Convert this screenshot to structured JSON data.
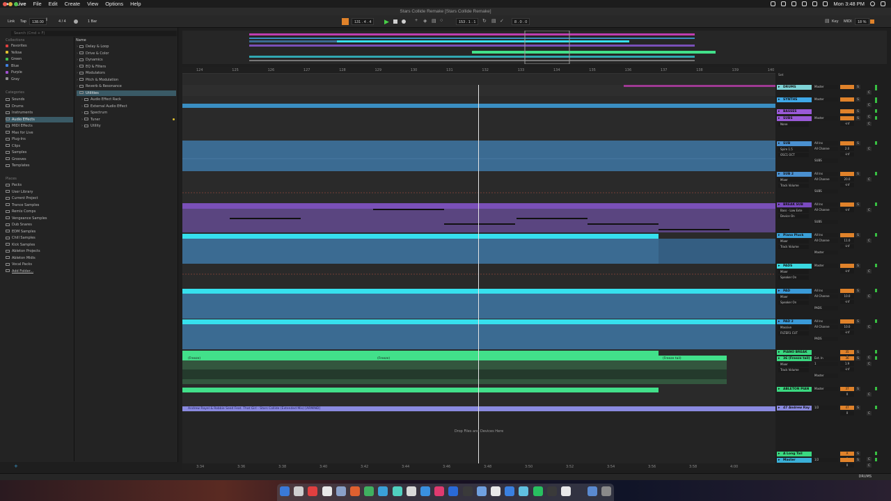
{
  "menubar": {
    "apple": "",
    "app": "Live",
    "items": [
      "File",
      "Edit",
      "Create",
      "View",
      "Options",
      "Help"
    ],
    "clock": "Mon 3:48 PM"
  },
  "window": {
    "title": "Stars Collide Remake  [Stars Collide Remake]"
  },
  "transport": {
    "link": "Link",
    "tap": "Tap",
    "tempo": "138.00",
    "signature": "4 / 4",
    "quantize": "1 Bar",
    "position": "131 .  4 .  4",
    "punch_in": "153 .  1 .  1",
    "loop_len": "8 .  0 .  0",
    "key": "Key",
    "midi": "MIDI",
    "cpu": "18 %"
  },
  "browser": {
    "search_placeholder": "Search (Cmd + F)",
    "collections_header": "Collections",
    "collections": [
      {
        "label": "Favorites",
        "color": "#e04040"
      },
      {
        "label": "Yellow",
        "color": "#e0c030"
      },
      {
        "label": "Green",
        "color": "#40c050"
      },
      {
        "label": "Blue",
        "color": "#4080e0"
      },
      {
        "label": "Purple",
        "color": "#a050d0"
      },
      {
        "label": "Gray",
        "color": "#909090"
      }
    ],
    "categories_header": "Categories",
    "categories": [
      "Sounds",
      "Drums",
      "Instruments",
      "Audio Effects",
      "MIDI Effects",
      "Max for Live",
      "Plug-Ins",
      "Clips",
      "Samples",
      "Grooves",
      "Templates"
    ],
    "places_header": "Places",
    "places": [
      "Packs",
      "User Library",
      "Current Project",
      "Trance Samples",
      "Remix Comps",
      "Vengeance Samples",
      "Dub Snares",
      "EDM Samples",
      "Chill Samples",
      "Kick Samples",
      "Ableton Projects",
      "Ableton Midis",
      "Vocal Packs",
      "Add Folder..."
    ],
    "name_header": "Name",
    "items": [
      "Delay & Loop",
      "Drive & Color",
      "Dynamics",
      "EQ & Filters",
      "Modulators",
      "Pitch & Modulation",
      "Reverb & Resonance",
      "Utilities",
      "Audio Effect Rack",
      "External Audio Effect",
      "Spectrum",
      "Tuner",
      "Utility"
    ]
  },
  "ruler": [
    "124",
    "125",
    "126",
    "127",
    "128",
    "129",
    "130",
    "131",
    "132",
    "133",
    "134",
    "135",
    "136",
    "137",
    "138",
    "139",
    "140"
  ],
  "time_ruler": [
    "3:34",
    "3:36",
    "3:38",
    "3:40",
    "3:42",
    "3:44",
    "3:46",
    "3:48",
    "3:50",
    "3:52",
    "3:54",
    "3:56",
    "3:58",
    "4:00"
  ],
  "clips": {
    "freeze_1": "(Freeze)",
    "freeze_2": "(Freeze)",
    "freeze_3": "(Freeze tail)",
    "audio_ref": "Andrew Rayel & Robbie Seed Feat. That Girl - Stars Collide (Extended Mix) [ARMIND]"
  },
  "drop_text": "Drop Files and Devices Here",
  "set_label": "Set",
  "tracks": [
    {
      "name": "DRUMS",
      "color": "#7fd3d6",
      "out": "Master",
      "num": ""
    },
    {
      "name": "SYNTHS",
      "color": "#3fa8e8",
      "out": "Master",
      "num": ""
    },
    {
      "name": "BASSES",
      "color": "#9a5ad8",
      "out": "",
      "num": ""
    },
    {
      "name": "SUBS",
      "color": "#9a5ad8",
      "sel": "None",
      "out": "Master",
      "num": "",
      "vol": "-inf"
    },
    {
      "name": "SUB",
      "color": "#4a90d0",
      "sel": "Spire 1.5",
      "sel2": "OSC1 OCT",
      "in": "All Ins",
      "ch": "All Channe",
      "out": "SUBS",
      "num": "",
      "vol": "2.0",
      "vol2": "-inf"
    },
    {
      "name": "SUB 2",
      "color": "#4a90d0",
      "sel": "Mixer",
      "sel2": "Track Volume",
      "in": "All Ins",
      "ch": "All Channe",
      "out": "SUBS",
      "num": "",
      "vol": "20.0",
      "vol2": "-inf"
    },
    {
      "name": "BREAK SUB",
      "color": "#7a4ac0",
      "sel": "Bass - Low Exte",
      "sel2": "Device On",
      "in": "All Ins",
      "ch": "All Channe",
      "out": "SUBS",
      "num": "",
      "vol": "-inf"
    },
    {
      "name": "Piano Pluck",
      "color": "#3aa0d8",
      "sel": "Mixer",
      "sel2": "Track Volume",
      "in": "All Ins",
      "ch": "All Channe",
      "out": "Master",
      "num": "",
      "vol": "11.0",
      "vol2": "-inf"
    },
    {
      "name": "PADS",
      "color": "#3ad8e0",
      "sel": "Mixer",
      "sel2": "Speaker On",
      "out": "Master",
      "num": "",
      "vol": "-inf"
    },
    {
      "name": "PAD",
      "color": "#3a9ad8",
      "sel": "Mixer",
      "sel2": "Speaker On",
      "in": "All Ins",
      "ch": "All Channe",
      "out": "PADS",
      "num": "",
      "vol": "10.0",
      "vol2": "-inf"
    },
    {
      "name": "PAD 2",
      "color": "#3a9ad8",
      "sel": "Massive",
      "sel2": "FILTER1 CUT",
      "in": "All Ins",
      "ch": "All Channe",
      "out": "PADS",
      "num": "",
      "vol": "10.0",
      "vol2": "-inf"
    },
    {
      "name": "PIANO BREAK",
      "color": "#3ad880",
      "out": "",
      "num": "35",
      "vol": "0"
    },
    {
      "name": "36 (Freeze tail)",
      "color": "#3ad880",
      "sel": "Mixer",
      "sel2": "Track Volume",
      "in": "Ext. In",
      "ch": "1",
      "out": "Master",
      "num": "36",
      "vol": "1.9",
      "vol2": "-inf"
    },
    {
      "name": "ABLETON PIAN",
      "color": "#3ad880",
      "out": "Master",
      "num": "37",
      "vol": "0"
    },
    {
      "name": "47 Andrew Ray",
      "color": "#8a8ae0",
      "in": "1/2",
      "num": "47",
      "vol": "0"
    },
    {
      "name": "A Long Tail",
      "color": "#3ad880",
      "out": "",
      "num": "A",
      "vol": "0"
    },
    {
      "name": "Master",
      "color": "#3ab0d8",
      "in": "1/2",
      "num": "",
      "vol": "0"
    }
  ],
  "status": {
    "selected_track": "DRUMS"
  },
  "colors": {
    "accent_orange": "#e0822a",
    "clip_cyan": "#36e0ee",
    "clip_blue": "#3b6b92",
    "clip_purple": "#7a50b8",
    "clip_green": "#42e08a",
    "clip_magenta": "#d040c0"
  }
}
